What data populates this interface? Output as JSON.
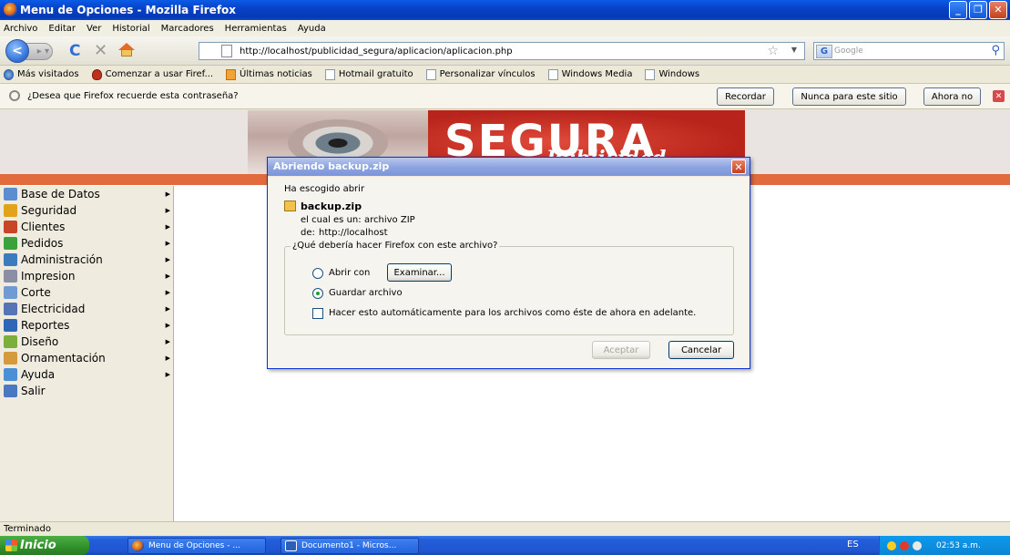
{
  "window": {
    "title": "Menu de Opciones - Mozilla Firefox"
  },
  "menubar": {
    "items": [
      "Archivo",
      "Editar",
      "Ver",
      "Historial",
      "Marcadores",
      "Herramientas",
      "Ayuda"
    ]
  },
  "navbar": {
    "url": "http://localhost/publicidad_segura/aplicacion/aplicacion.php",
    "search_placeholder": "Google"
  },
  "bookmarks": {
    "items": [
      "Más visitados",
      "Comenzar a usar Firef...",
      "Últimas noticias",
      "Hotmail gratuito",
      "Personalizar vínculos",
      "Windows Media",
      "Windows"
    ]
  },
  "notification": {
    "message": "¿Desea que Firefox recuerde esta contraseña?",
    "remember": "Recordar",
    "never": "Nunca para este sitio",
    "not_now": "Ahora no"
  },
  "banner": {
    "title": "SEGURA",
    "subtitle": "Publicidad"
  },
  "sidebar": {
    "items": [
      {
        "label": "Base de Datos",
        "color": "#5a8ed0",
        "arrow": true
      },
      {
        "label": "Seguridad",
        "color": "#e2a31c",
        "arrow": true
      },
      {
        "label": "Clientes",
        "color": "#c84628",
        "arrow": true
      },
      {
        "label": "Pedidos",
        "color": "#3aa23a",
        "arrow": true
      },
      {
        "label": "Administración",
        "color": "#3d7bbf",
        "arrow": true
      },
      {
        "label": "Impresion",
        "color": "#8a8fa6",
        "arrow": true
      },
      {
        "label": "Corte",
        "color": "#6f9ad4",
        "arrow": true
      },
      {
        "label": "Electricidad",
        "color": "#5575b5",
        "arrow": true
      },
      {
        "label": "Reportes",
        "color": "#2f66b8",
        "arrow": true
      },
      {
        "label": "Diseño",
        "color": "#7cae3c",
        "arrow": true
      },
      {
        "label": "Ornamentación",
        "color": "#d59a3c",
        "arrow": true
      },
      {
        "label": "Ayuda",
        "color": "#4b8fd6",
        "arrow": true
      },
      {
        "label": "Salir",
        "color": "#4a79c2",
        "arrow": false
      }
    ]
  },
  "dialog": {
    "title": "Abriendo backup.zip",
    "intro": "Ha escogido abrir",
    "filename": "backup.zip",
    "type_label": "el cual es un:",
    "type_value": "archivo ZIP",
    "from_label": "de:",
    "from_value": "http://localhost",
    "question": "¿Qué debería hacer Firefox con este archivo?",
    "open_with": "Abrir con",
    "browse": "Examinar...",
    "save_file": "Guardar archivo",
    "save_selected": true,
    "auto_checkbox": "Hacer esto automáticamente para los archivos como éste de ahora en adelante.",
    "auto_checked": false,
    "accept": "Aceptar",
    "cancel": "Cancelar"
  },
  "status": {
    "text": "Terminado"
  },
  "taskbar": {
    "start": "Inicio",
    "tasks": [
      "Menu de Opciones - ...",
      "Documento1 - Micros..."
    ],
    "language": "ES",
    "clock": "02:53 a.m."
  }
}
